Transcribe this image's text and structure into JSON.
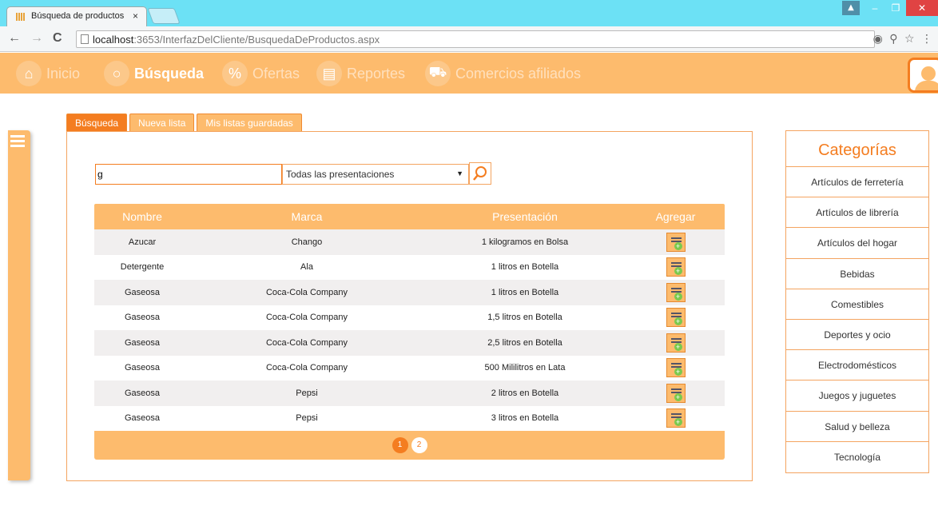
{
  "browser": {
    "tab_title": "Búsqueda de productos",
    "tab_close": "×",
    "url_host": "localhost",
    "url_path": ":3653/InterfazDelCliente/BusquedaDeProductos.aspx"
  },
  "navbar": {
    "items": [
      {
        "label": "Inicio",
        "icon": "home-icon"
      },
      {
        "label": "Búsqueda",
        "icon": "search-icon"
      },
      {
        "label": "Ofertas",
        "icon": "percent-icon"
      },
      {
        "label": "Reportes",
        "icon": "clipboard-icon"
      },
      {
        "label": "Comercios afiliados",
        "icon": "cart-icon"
      }
    ],
    "active": "Búsqueda"
  },
  "tabs": [
    "Búsqueda",
    "Nueva lista",
    "Mis listas guardadas"
  ],
  "search": {
    "value": "g",
    "presentation_selected": "Todas las presentaciones"
  },
  "table": {
    "headers": [
      "Nombre",
      "Marca",
      "Presentación",
      "Agregar"
    ],
    "rows": [
      {
        "nombre": "Azucar",
        "marca": "Chango",
        "presentacion": "1 kilogramos en Bolsa"
      },
      {
        "nombre": "Detergente",
        "marca": "Ala",
        "presentacion": "1 litros en Botella"
      },
      {
        "nombre": "Gaseosa",
        "marca": "Coca-Cola Company",
        "presentacion": "1 litros en Botella"
      },
      {
        "nombre": "Gaseosa",
        "marca": "Coca-Cola Company",
        "presentacion": "1,5 litros en Botella"
      },
      {
        "nombre": "Gaseosa",
        "marca": "Coca-Cola Company",
        "presentacion": "2,5 litros en Botella"
      },
      {
        "nombre": "Gaseosa",
        "marca": "Coca-Cola Company",
        "presentacion": "500 Mililitros en Lata"
      },
      {
        "nombre": "Gaseosa",
        "marca": "Pepsi",
        "presentacion": "2 litros en Botella"
      },
      {
        "nombre": "Gaseosa",
        "marca": "Pepsi",
        "presentacion": "3 litros en Botella"
      }
    ],
    "pages": [
      "1",
      "2"
    ],
    "current_page": "1"
  },
  "categories": {
    "title": "Categorías",
    "items": [
      "Artículos de ferretería",
      "Artículos de librería",
      "Artículos del hogar",
      "Bebidas",
      "Comestibles",
      "Deportes y ocio",
      "Electrodomésticos",
      "Juegos y juguetes",
      "Salud y belleza",
      "Tecnología"
    ]
  },
  "colors": {
    "accent": "#f47d20",
    "accent_light": "#fdbb6d",
    "browser_frame": "#6ce1f5"
  }
}
